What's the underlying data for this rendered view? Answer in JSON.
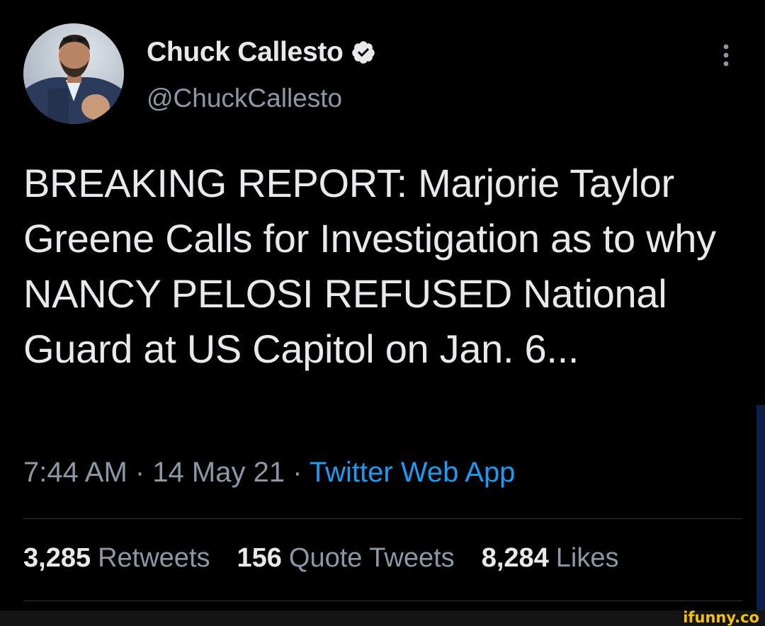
{
  "tweet": {
    "display_name": "Chuck Callesto",
    "handle": "@ChuckCallesto",
    "verified_icon": "verified-badge-icon",
    "more_icon": "more-vertical-icon",
    "text": "BREAKING REPORT: Marjorie Taylor Greene Calls for Investigation as to why NANCY PELOSI REFUSED National Guard at US Capitol on Jan. 6...",
    "time": "7:44 AM",
    "separator": " · ",
    "date": "14 May 21",
    "source": "Twitter Web App"
  },
  "stats": {
    "retweets_count": "3,285",
    "retweets_label": "Retweets",
    "quotes_count": "156",
    "quotes_label": "Quote Tweets",
    "likes_count": "8,284",
    "likes_label": "Likes"
  },
  "watermark": {
    "text": "ifunny.co"
  },
  "colors": {
    "background": "#000000",
    "primary_text": "#e7e9ea",
    "secondary_text": "#8b98a5",
    "link": "#1d9bf0",
    "divider": "#2f3336",
    "watermark": "#f2c200"
  }
}
